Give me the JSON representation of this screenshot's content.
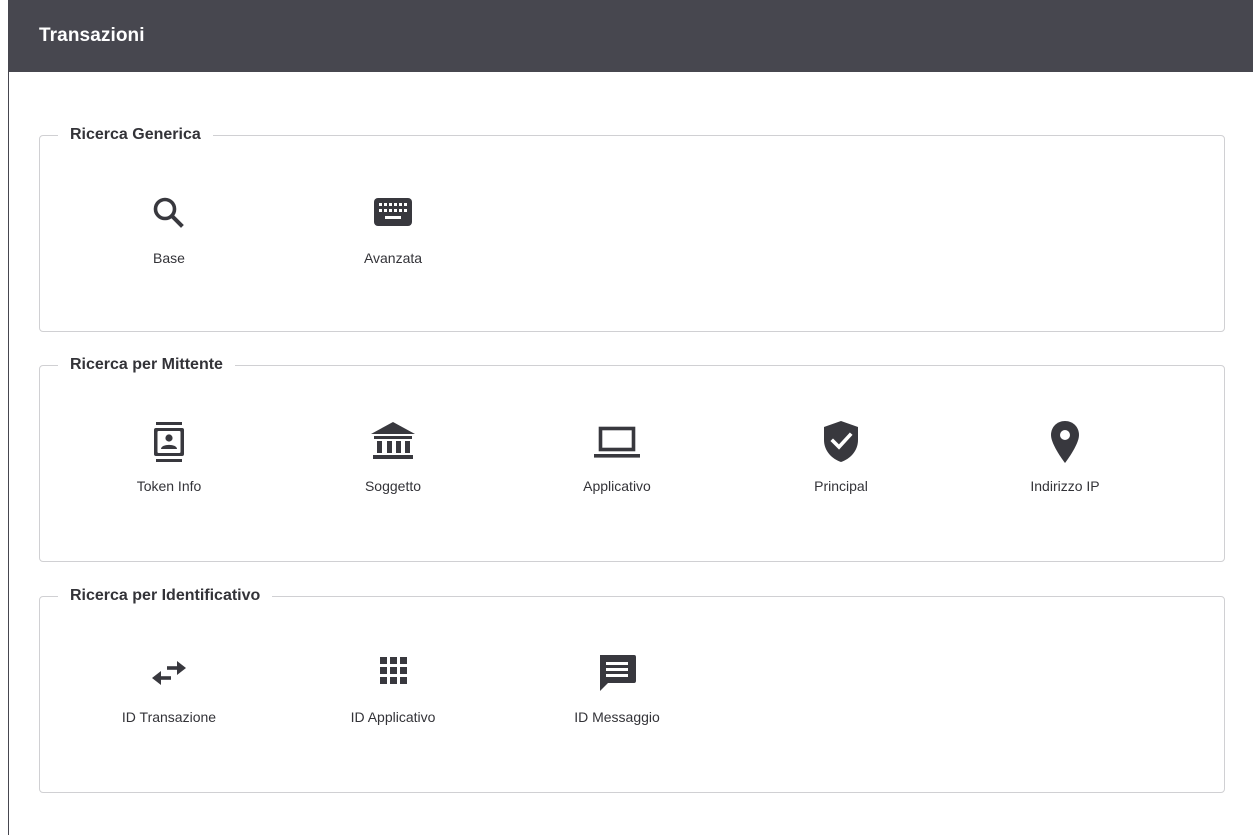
{
  "header": {
    "title": "Transazioni"
  },
  "sections": [
    {
      "legend": "Ricerca Generica",
      "items": [
        {
          "label": "Base",
          "icon": "search-icon"
        },
        {
          "label": "Avanzata",
          "icon": "keyboard-icon"
        }
      ]
    },
    {
      "legend": "Ricerca per Mittente",
      "items": [
        {
          "label": "Token Info",
          "icon": "contact-card-icon"
        },
        {
          "label": "Soggetto",
          "icon": "institution-icon"
        },
        {
          "label": "Applicativo",
          "icon": "laptop-icon"
        },
        {
          "label": "Principal",
          "icon": "verified-shield-icon"
        },
        {
          "label": "Indirizzo IP",
          "icon": "location-pin-icon"
        }
      ]
    },
    {
      "legend": "Ricerca per Identificativo",
      "items": [
        {
          "label": "ID Transazione",
          "icon": "swap-arrows-icon"
        },
        {
          "label": "ID Applicativo",
          "icon": "grid-icon"
        },
        {
          "label": "ID Messaggio",
          "icon": "message-icon"
        }
      ]
    }
  ],
  "colors": {
    "header_bg": "#47474f",
    "icon": "#38383e",
    "text": "#333338",
    "border": "#d0d0d3"
  }
}
